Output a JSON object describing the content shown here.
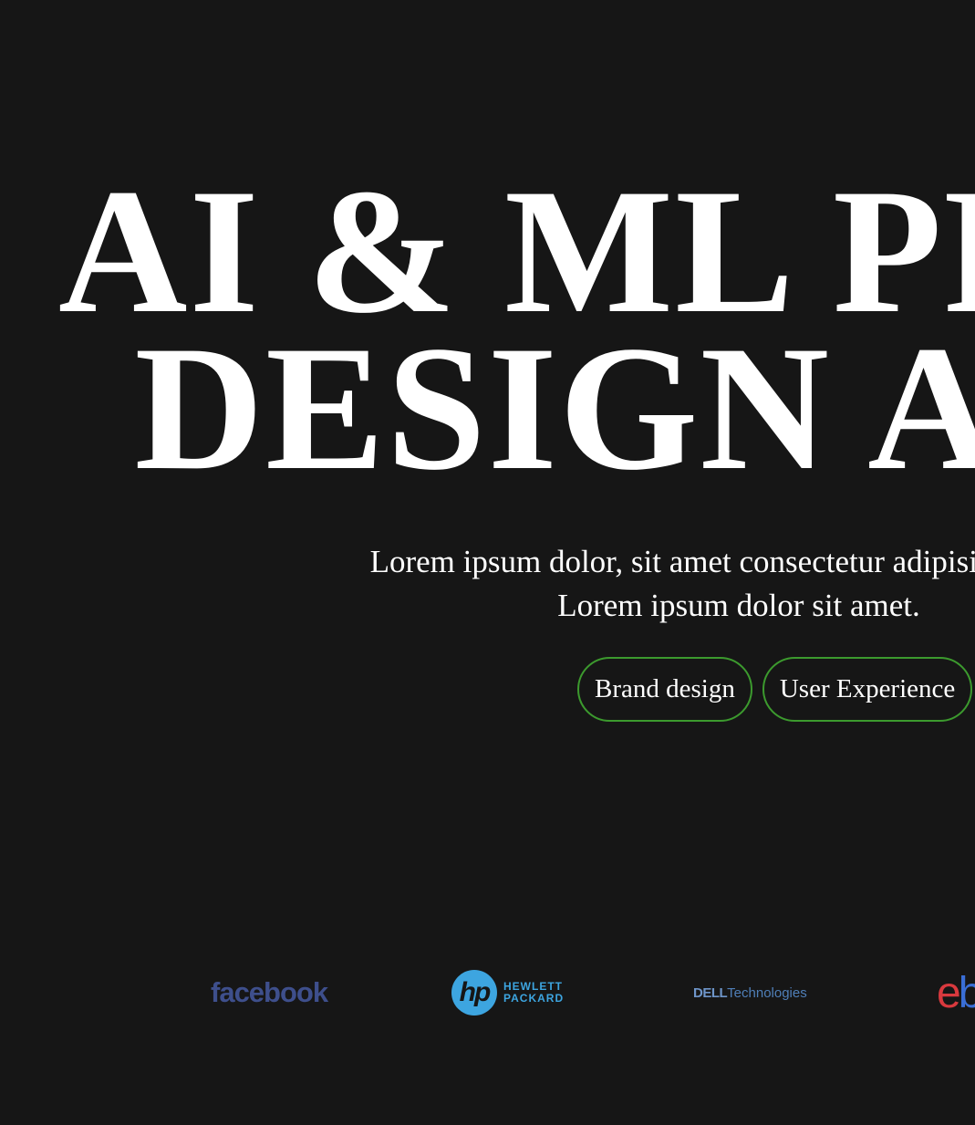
{
  "hero": {
    "headline_line_1": "AI & ML PRODUCT",
    "headline_line_2": "DESIGN AGENCY",
    "subtitle_line_1": "Lorem ipsum dolor, sit amet consectetur adipisicing elit.",
    "subtitle_line_2": "Lorem ipsum dolor sit amet."
  },
  "tags": [
    {
      "label": "Brand design"
    },
    {
      "label": "User Experience"
    }
  ],
  "logos": {
    "facebook": "facebook",
    "hp_mark": "hp",
    "hp_line_1": "HEWLETT",
    "hp_line_2": "PACKARD",
    "dell_bold": "DELL",
    "dell_rest": "Technologies",
    "ebay_e": "e",
    "ebay_b": "b"
  },
  "colors": {
    "background": "#161616",
    "text": "#ffffff",
    "tag_border": "#3c9a2e"
  }
}
